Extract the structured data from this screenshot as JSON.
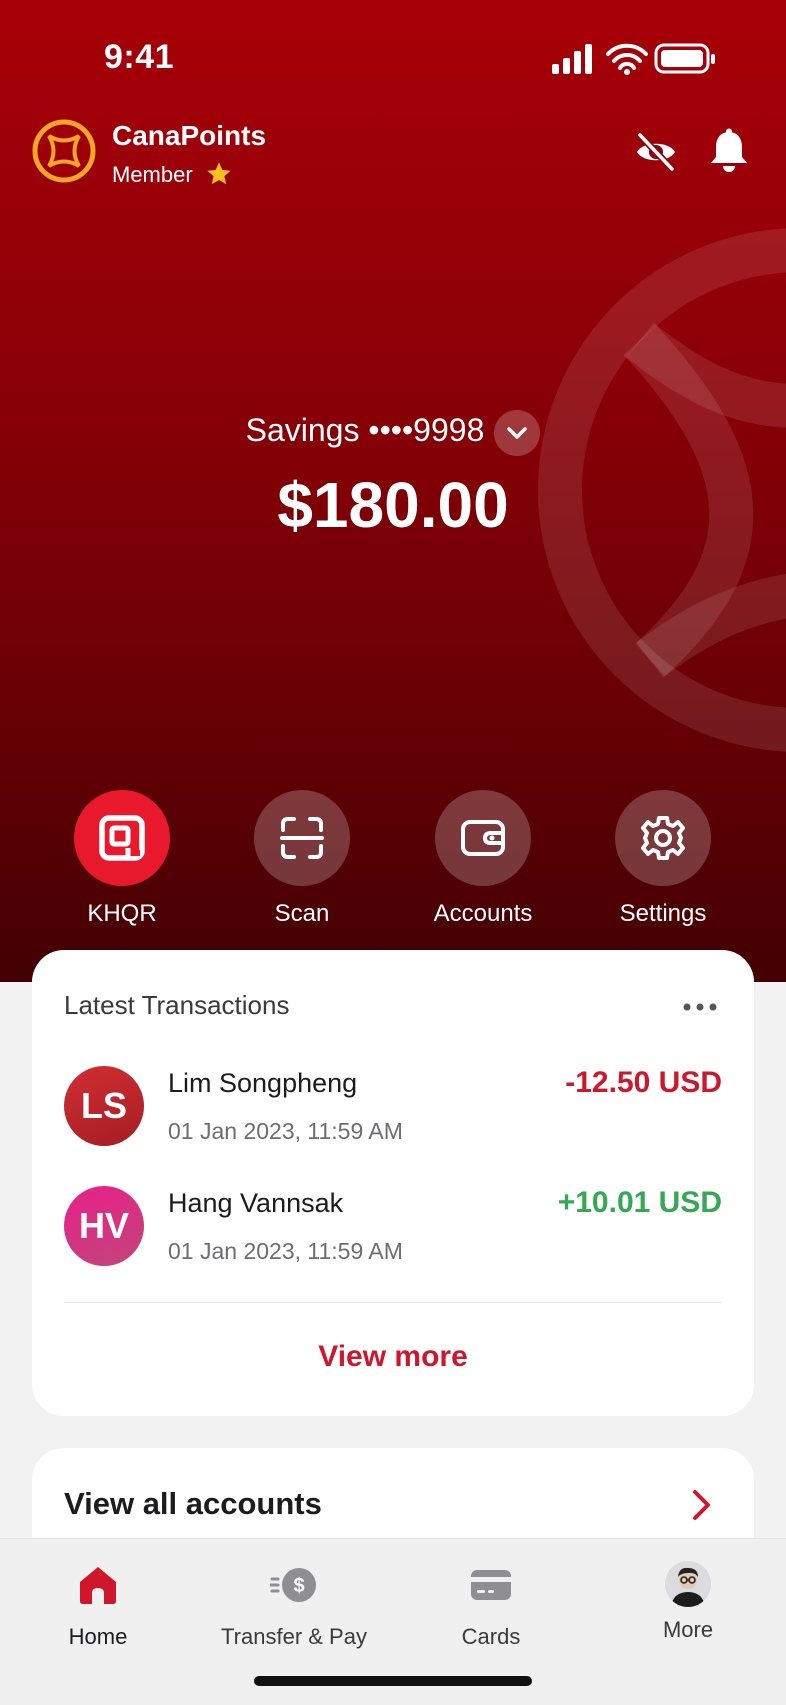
{
  "status_bar": {
    "time": "9:41"
  },
  "header": {
    "brand_title": "CanaPoints",
    "member_label": "Member",
    "icons": {
      "logo": "canapoints-logo",
      "star": "star-icon",
      "hide_balance": "eye-off-icon",
      "notifications": "bell-icon"
    }
  },
  "account": {
    "label": "Savings ••••9998",
    "balance": "$180.00"
  },
  "actions": [
    {
      "label": "KHQR",
      "icon": "khqr-icon"
    },
    {
      "label": "Scan",
      "icon": "scan-icon"
    },
    {
      "label": "Accounts",
      "icon": "wallet-icon"
    },
    {
      "label": "Settings",
      "icon": "gear-icon"
    }
  ],
  "transactions": {
    "title": "Latest Transactions",
    "items": [
      {
        "initials": "LS",
        "name": "Lim Songpheng",
        "date": "01 Jan 2023, 11:59 AM",
        "amount": "-12.50 USD",
        "amount_color": "#d0162b",
        "avatar_color": "#c0272d"
      },
      {
        "initials": "HV",
        "name": "Hang Vannsak",
        "date": "01 Jan 2023, 11:59 AM",
        "amount": "+10.01 USD",
        "amount_color": "#34a853",
        "avatar_color": "#d63384"
      }
    ],
    "view_more": "View more"
  },
  "all_accounts": {
    "label": "View all accounts"
  },
  "tabbar": {
    "tabs": [
      {
        "label": "Home",
        "icon": "home-icon",
        "active": true
      },
      {
        "label": "Transfer & Pay",
        "icon": "transfer-pay-icon",
        "active": false
      },
      {
        "label": "Cards",
        "icon": "card-icon",
        "active": false
      },
      {
        "label": "More",
        "icon": "profile-avatar",
        "active": false
      }
    ]
  },
  "colors": {
    "brand_red": "#a80008",
    "accent_red": "#e8192c",
    "negative": "#d0162b",
    "positive": "#34a853"
  }
}
